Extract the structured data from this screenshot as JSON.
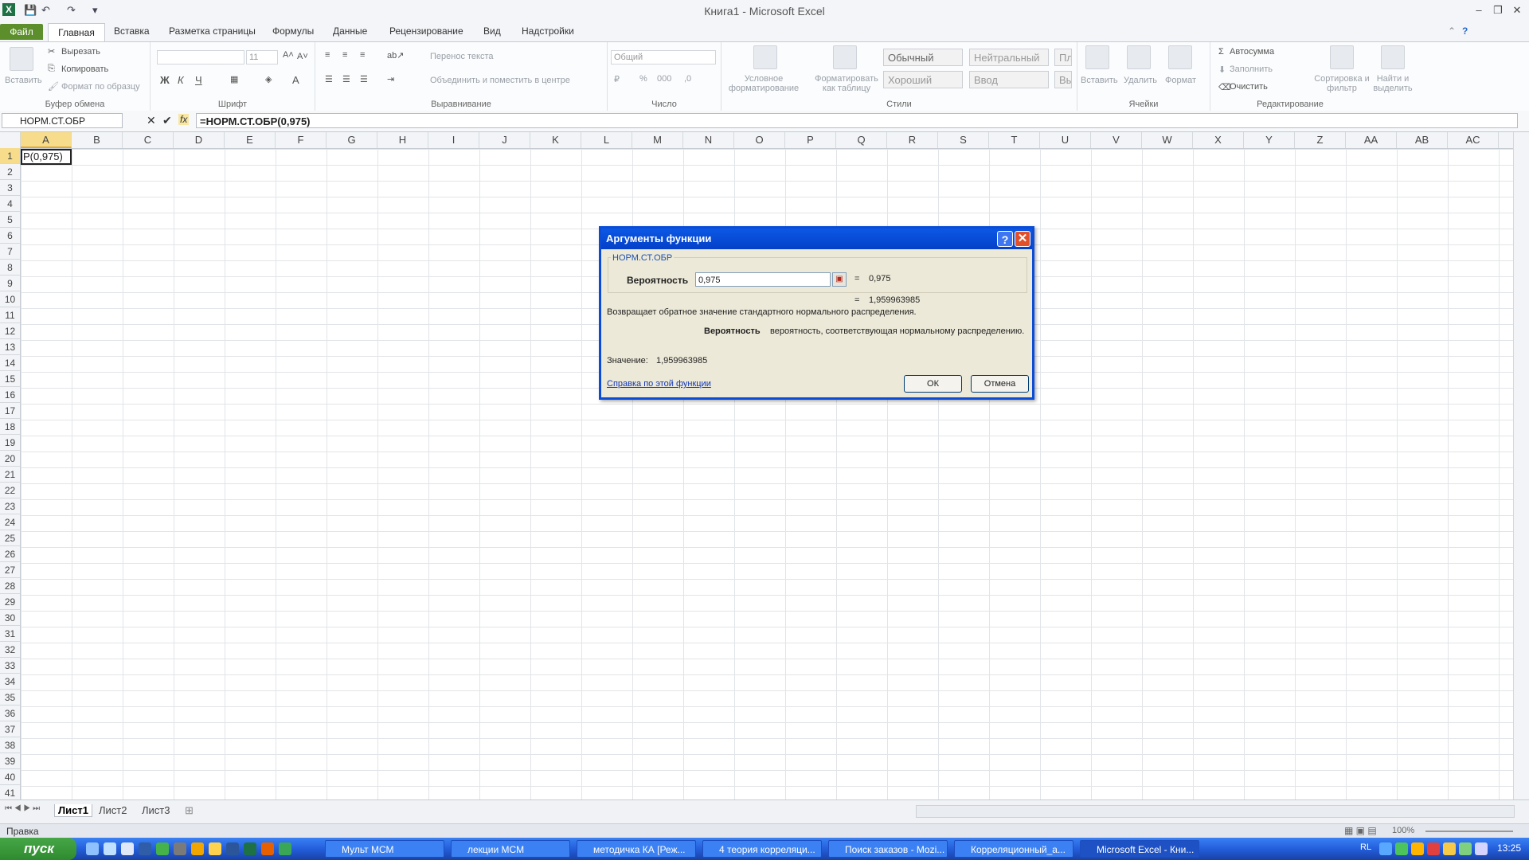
{
  "window": {
    "title": "Книга1 - Microsoft Excel",
    "minimize": "–",
    "restore": "❐",
    "close": "✕"
  },
  "ribbon": {
    "tabs": [
      "Файл",
      "Главная",
      "Вставка",
      "Разметка страницы",
      "Формулы",
      "Данные",
      "Рецензирование",
      "Вид",
      "Надстройки"
    ],
    "clipboard": {
      "paste": "Вставить",
      "cut": "Вырезать",
      "copy": "Копировать",
      "format_painter": "Формат по образцу",
      "label": "Буфер обмена"
    },
    "font": {
      "size": "11",
      "label": "Шрифт",
      "bold": "Ж",
      "italic": "К",
      "underline": "Ч"
    },
    "alignment": {
      "wrap": "Перенос текста",
      "merge": "Объединить и поместить в центре",
      "label": "Выравнивание"
    },
    "number": {
      "format": "Общий",
      "label": "Число"
    },
    "styles": {
      "conditional": "Условное форматирование",
      "as_table": "Форматировать как таблицу",
      "normal": "Обычный",
      "neutral": "Нейтральный",
      "bad": "Плохой",
      "good": "Хороший",
      "input": "Ввод",
      "output": "Вывод",
      "label": "Стили"
    },
    "cells": {
      "insert": "Вставить",
      "delete": "Удалить",
      "format": "Формат",
      "label": "Ячейки"
    },
    "editing": {
      "autosum": "Автосумма",
      "fill": "Заполнить",
      "clear": "Очистить",
      "sort": "Сортировка и фильтр",
      "find": "Найти и выделить",
      "label": "Редактирование"
    }
  },
  "formula_bar": {
    "name_box": "НОРМ.СТ.ОБР",
    "formula": "=НОРМ.СТ.ОБР(0,975)"
  },
  "grid": {
    "columns": [
      "A",
      "B",
      "C",
      "D",
      "E",
      "F",
      "G",
      "H",
      "I",
      "J",
      "K",
      "L",
      "M",
      "N",
      "O",
      "P",
      "Q",
      "R",
      "S",
      "T",
      "U",
      "V",
      "W",
      "X",
      "Y",
      "Z",
      "AA",
      "AB",
      "AC"
    ],
    "row_count": 41,
    "active_cell_text": "Р(0,975)"
  },
  "sheets": [
    "Лист1",
    "Лист2",
    "Лист3"
  ],
  "status": {
    "mode": "Правка",
    "zoom": "100%"
  },
  "dialog": {
    "title": "Аргументы функции",
    "help": "?",
    "close": "✕",
    "function_name": "НОРМ.СТ.ОБР",
    "arg_label": "Вероятность",
    "arg_value": "0,975",
    "arg_eq": "=",
    "arg_result": "0,975",
    "result_eq": "=",
    "result": "1,959963985",
    "description": "Возвращает обратное значение стандартного нормального распределения.",
    "arg_desc_name": "Вероятность",
    "arg_desc_text": "вероятность, соответствующая нормальному распределению.",
    "value_label": "Значение:",
    "value": "1,959963985",
    "help_link": "Справка по этой функции",
    "ok": "ОК",
    "cancel": "Отмена"
  },
  "taskbar": {
    "start": "пуск",
    "tasks": [
      "Мульт МСМ",
      "лекции МСМ",
      "методичка КА [Реж...",
      "4 теория корреляци...",
      "Поиск заказов - Mozi...",
      "Корреляционный_а...",
      "Microsoft Excel - Кни..."
    ],
    "clock": "13:25",
    "lang": "RL"
  }
}
